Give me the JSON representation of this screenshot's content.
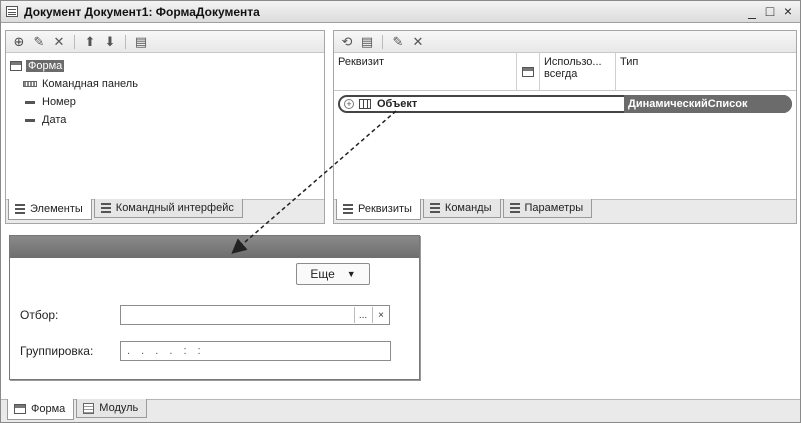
{
  "window": {
    "title": "Документ Документ1: ФормаДокумента",
    "controls": {
      "minimize": "_",
      "maximize": "□",
      "close": "×"
    }
  },
  "left_panel": {
    "toolbar": {
      "add": "⊕",
      "edit": "✎",
      "delete": "✕",
      "move_up": "⬆",
      "move_down": "⬇",
      "extra": "▤"
    },
    "tree": {
      "root": "Форма",
      "children": [
        "Командная панель",
        "Номер",
        "Дата"
      ]
    },
    "tabs": [
      "Элементы",
      "Командный интерфейс"
    ]
  },
  "right_panel": {
    "toolbar": {
      "b1": "⟲",
      "b2": "▤",
      "edit": "✎",
      "delete": "✕"
    },
    "columns": {
      "attribute": "Реквизит",
      "use_always": "Использо... всегда",
      "type": "Тип"
    },
    "rows": [
      {
        "name": "Объект",
        "type": "ДинамическийСписок"
      }
    ],
    "tabs": [
      "Реквизиты",
      "Команды",
      "Параметры"
    ]
  },
  "preview": {
    "more_button": "Еще",
    "more_arrow": "▼",
    "filter_label": "Отбор:",
    "filter_dots": "...",
    "filter_clear": "×",
    "grouping_label": "Группировка:",
    "grouping_value": ". . . . : :"
  },
  "bottom_tabs": [
    "Форма",
    "Модуль"
  ],
  "colors": {
    "accent": "#6b6b6b",
    "panel_bg": "#eaeaea"
  }
}
